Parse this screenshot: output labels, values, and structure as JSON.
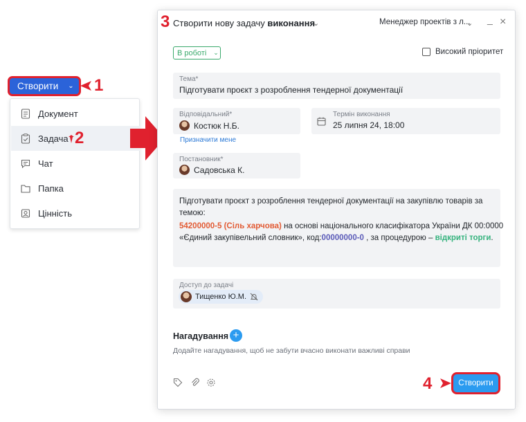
{
  "create_button": {
    "label": "Створити"
  },
  "annotations": {
    "n1": "1",
    "n2": "2",
    "n3": "3",
    "n4": "4"
  },
  "menu": {
    "items": [
      {
        "label": "Документ",
        "icon": "document-icon"
      },
      {
        "label": "Задача",
        "icon": "task-icon"
      },
      {
        "label": "Чат",
        "icon": "chat-icon"
      },
      {
        "label": "Папка",
        "icon": "folder-icon"
      },
      {
        "label": "Цінність",
        "icon": "value-icon"
      }
    ]
  },
  "dialog": {
    "title_prefix": "Створити нову задачу",
    "title_bold": "виконання",
    "project": "Менеджер проектів з л...",
    "status": "В роботі",
    "high_priority_label": "Високий пріоритет",
    "high_priority_checked": false,
    "topic": {
      "label": "Тема*",
      "value": "Підготувати проєкт з розроблення тендерної документації"
    },
    "responsible": {
      "label": "Відповідальний*",
      "value": "Костюк Н.Б."
    },
    "assign_me": "Призначити мене",
    "deadline": {
      "label": "Термін виконання",
      "value": "25 липня 24, 18:00"
    },
    "setter": {
      "label": "Постановник*",
      "value": "Садовська К."
    },
    "description": {
      "line1": "Підготувати проєкт з розроблення тендерної документації на закупівлю товарів за",
      "line2": "темою:",
      "code_red": "54200000-5 (Сіль харчова)",
      "line3_mid": " на основі національного класифікатора України ДК 00:0000",
      "line4_start": "«Єдиний закупівельний словник», код:",
      "code_purple": "00000000-0",
      "line4_mid": " , за процедурою – ",
      "procedure_green": "відкриті торги",
      "line4_end": "."
    },
    "access": {
      "label": "Доступ до задачі",
      "person": "Тищенко Ю.М."
    },
    "reminders": {
      "title": "Нагадування",
      "hint": "Додайте нагадування, щоб не забути вчасно виконати важливі справи"
    },
    "submit_label": "Створити"
  },
  "colors": {
    "annotation": "#e0212e",
    "create_button": "#2b63d9",
    "primary": "#2b9bf0",
    "status_green": "#39a96b"
  }
}
